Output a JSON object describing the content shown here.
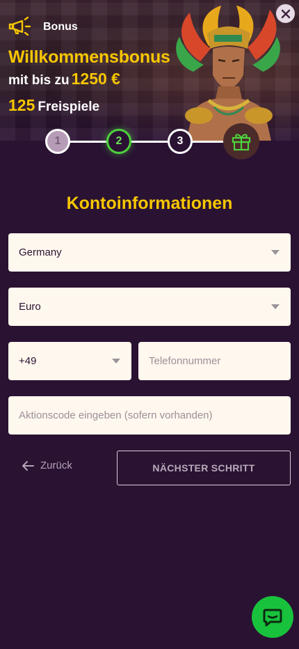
{
  "banner": {
    "label": "Bonus",
    "headline": "Willkommensbonus",
    "subline_prefix": "mit bis zu",
    "amount": "1250 €",
    "spins_count": "125",
    "spins_label": "Freispiele"
  },
  "stepper": {
    "steps": [
      "1",
      "2",
      "3"
    ],
    "active_step": 2
  },
  "form": {
    "title": "Kontoinformationen",
    "country_value": "Germany",
    "currency_value": "Euro",
    "phone_prefix_value": "+49",
    "phone_placeholder": "Telefonnummer",
    "promo_placeholder": "Aktionscode eingeben (sofern vorhanden)"
  },
  "actions": {
    "back_label": "Zurück",
    "next_label": "NÄCHSTER SCHRITT"
  },
  "icons": {
    "megaphone": "megaphone-icon",
    "close": "close-icon",
    "gift": "gift-icon",
    "chat": "chat-icon",
    "back_arrow": "arrow-left-icon"
  },
  "colors": {
    "background": "#2a1233",
    "accent_yellow": "#f7c600",
    "active_green": "#4ed23c",
    "field_bg": "#fff8ee",
    "chat_green": "#19c23c"
  }
}
